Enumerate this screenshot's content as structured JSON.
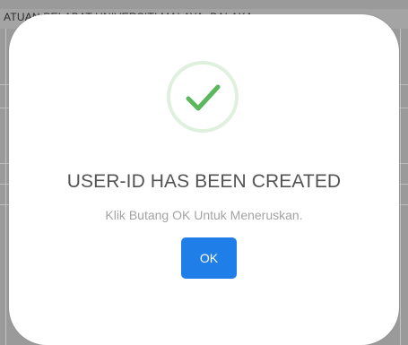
{
  "background": {
    "header_text": "ATUAN PELABAT UNIVERSITI MALAYA, BALAKA"
  },
  "dialog": {
    "icon": "checkmark-icon",
    "title": "USER-ID HAS BEEN CREATED",
    "message": "Klik Butang OK Untuk Meneruskan.",
    "ok_label": "OK"
  },
  "colors": {
    "success": "#5cb85c",
    "success_ring": "#dff0df",
    "button": "#1f7ee8"
  }
}
